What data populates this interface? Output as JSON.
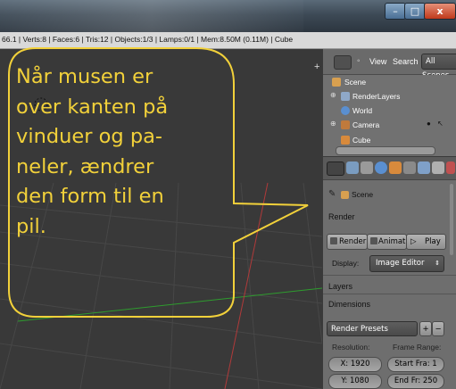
{
  "window": {
    "min_label": "–",
    "max_label": "□",
    "close_label": "x"
  },
  "info_bar": {
    "text": "66.1 | Verts:8 | Faces:6 | Tris:12 | Objects:1/3 | Lamps:0/1 | Mem:8.50M (0.11M) | Cube"
  },
  "callout": {
    "lines": [
      "Når musen er",
      "over kanten på",
      "vinduer og pa-",
      "neler, ændrer",
      "den form til en",
      "pil."
    ],
    "color": "#f2d13a"
  },
  "outliner": {
    "view_label": "View",
    "search_label": "Search",
    "filter_label": "All Scenes",
    "items": [
      "Scene",
      "RenderLayers",
      "World",
      "Camera",
      "Cube"
    ]
  },
  "properties": {
    "context_label": "Scene",
    "render_section": "Render",
    "render_buttons": [
      "Render",
      "Animati",
      "Play"
    ],
    "display_label": "Display:",
    "display_value": "Image Editor",
    "layers_section": "Layers",
    "dimensions_section": "Dimensions",
    "presets_label": "Render Presets",
    "resolution_label": "Resolution:",
    "frame_range_label": "Frame Range:",
    "res_x": "X: 1920",
    "res_y": "Y: 1080",
    "start_frame": "Start Fra: 1",
    "end_frame": "End Fr: 250"
  }
}
